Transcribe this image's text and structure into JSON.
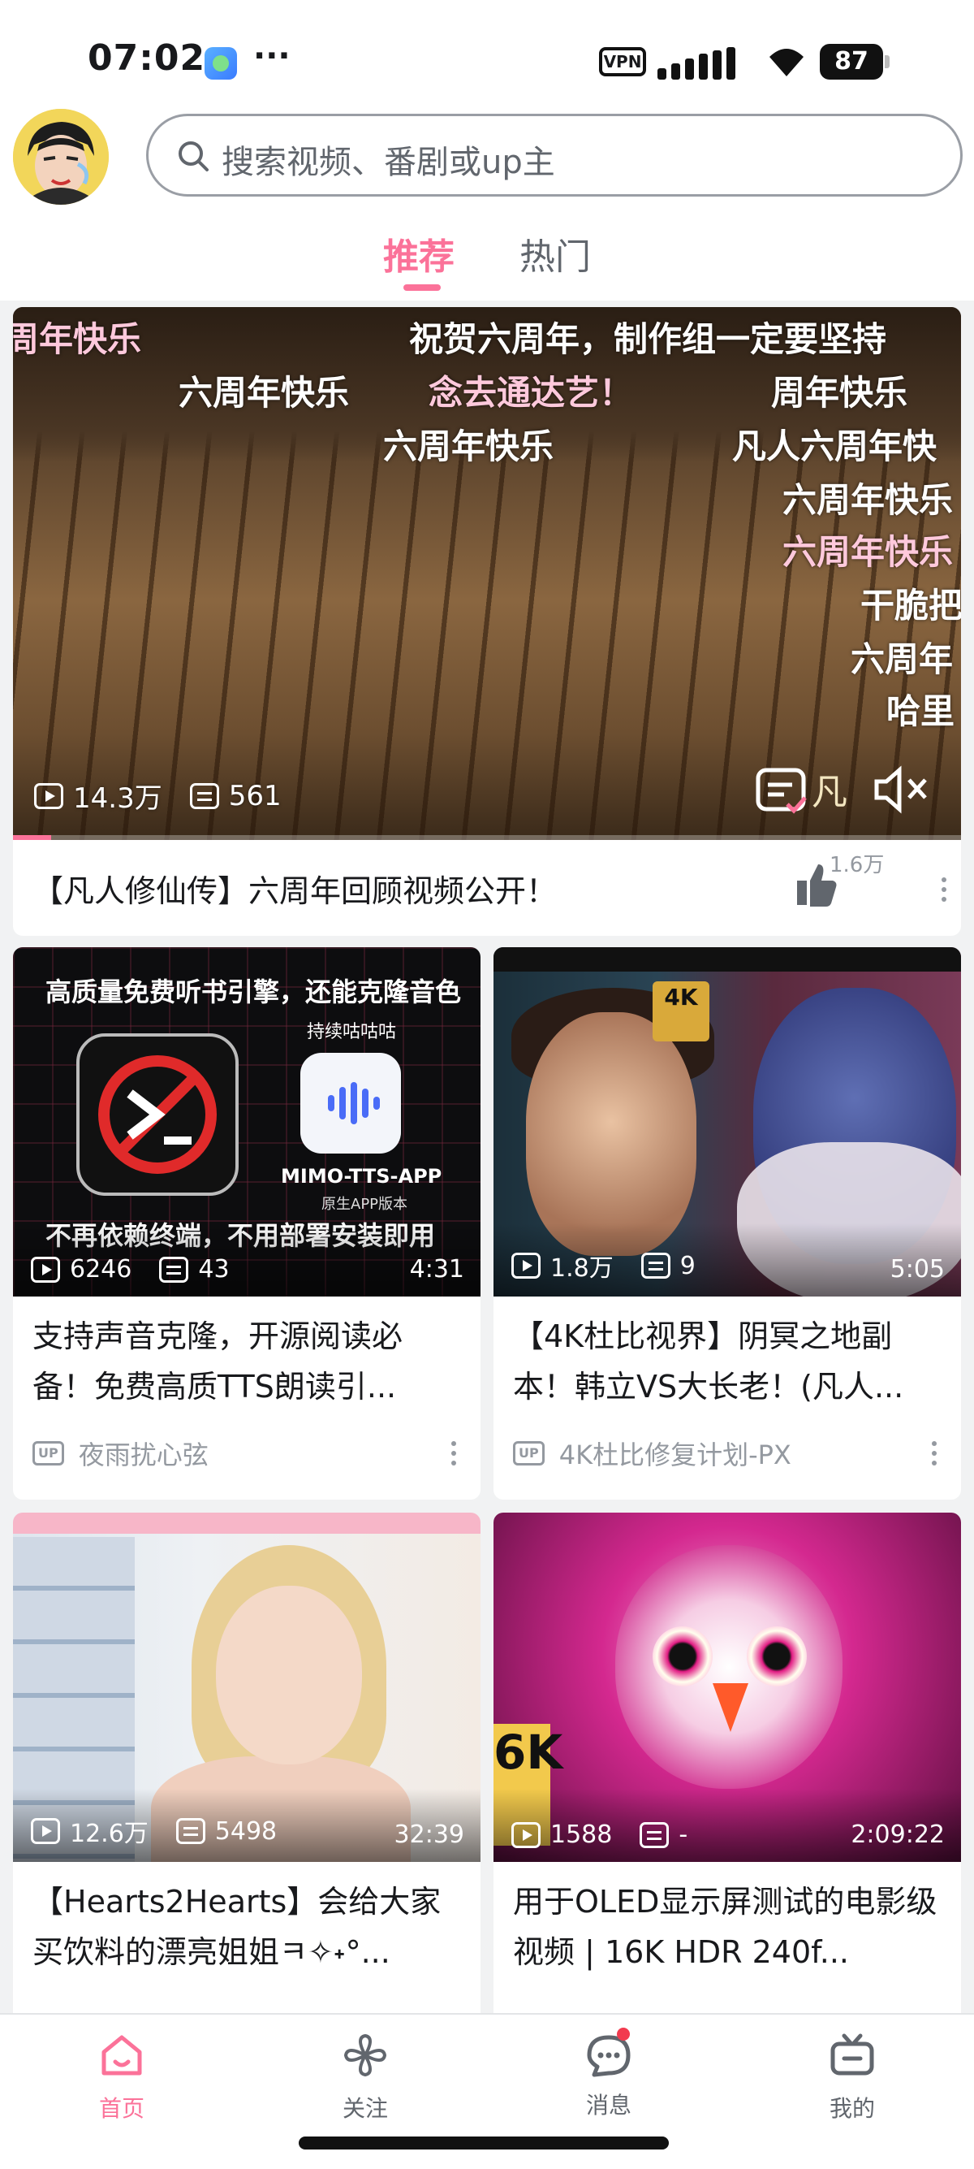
{
  "status_bar": {
    "time": "07:02",
    "vpn": "VPN",
    "battery": "87"
  },
  "header": {
    "search_placeholder": "搜索视频、番剧或up主",
    "tabs": [
      {
        "label": "推荐",
        "active": true
      },
      {
        "label": "热门",
        "active": false
      }
    ]
  },
  "featured": {
    "danmaku": [
      "周年快乐",
      "祝贺六周年，制作组一定要坚持",
      "六周年快乐",
      "念去通达艺！",
      "周年快乐",
      "六周年快乐",
      "凡人六周年快",
      "六周年快乐",
      "六周年快乐",
      "干脆把",
      "六周年",
      "哈里"
    ],
    "views": "14.3万",
    "danmaku_count": "561",
    "progress": 0.04,
    "title": "【凡人修仙传】六周年回顾视频公开！",
    "likes": "1.6万"
  },
  "cards": [
    {
      "thumb_heading": "高质量免费听书引擎，还能克隆音色",
      "thumb_sub": "持续咕咕咕",
      "thumb_app": "MIMO-TTS-APP",
      "thumb_app_sub": "原生APP版本",
      "thumb_footer": "不再依赖终端，不用部署安装即用",
      "views": "6246",
      "danmaku_count": "43",
      "duration": "4:31",
      "title": "支持声音克隆，开源阅读必备！免费高质TTS朗读引...",
      "uploader": "夜雨扰心弦"
    },
    {
      "thumb_badge": "4K",
      "views": "1.8万",
      "danmaku_count": "9",
      "duration": "5:05",
      "title": "【4K杜比视界】阴冥之地副本！韩立VS大长老！(凡人...",
      "uploader": "4K杜比修复计划-PX"
    },
    {
      "views": "12.6万",
      "danmaku_count": "5498",
      "duration": "32:39",
      "title": "【Hearts2Hearts】会给大家买饮料的漂亮姐姐ㅋ✧˖°...",
      "uploader": ""
    },
    {
      "thumb_badge": "6K",
      "views": "1588",
      "danmaku_count": "-",
      "duration": "2:09:22",
      "title": "用于OLED显示屏测试的电影级视频 | 16K HDR 240f...",
      "uploader": ""
    }
  ],
  "up_badge": "UP",
  "bottom_nav": [
    {
      "label": "首页",
      "icon": "home-icon",
      "active": true
    },
    {
      "label": "关注",
      "icon": "pinwheel-icon",
      "active": false
    },
    {
      "label": "消息",
      "icon": "message-icon",
      "active": false
    },
    {
      "label": "我的",
      "icon": "tv-icon",
      "active": false
    }
  ],
  "colors": {
    "accent": "#fb7299",
    "text": "#18191c",
    "muted": "#9499a0"
  }
}
